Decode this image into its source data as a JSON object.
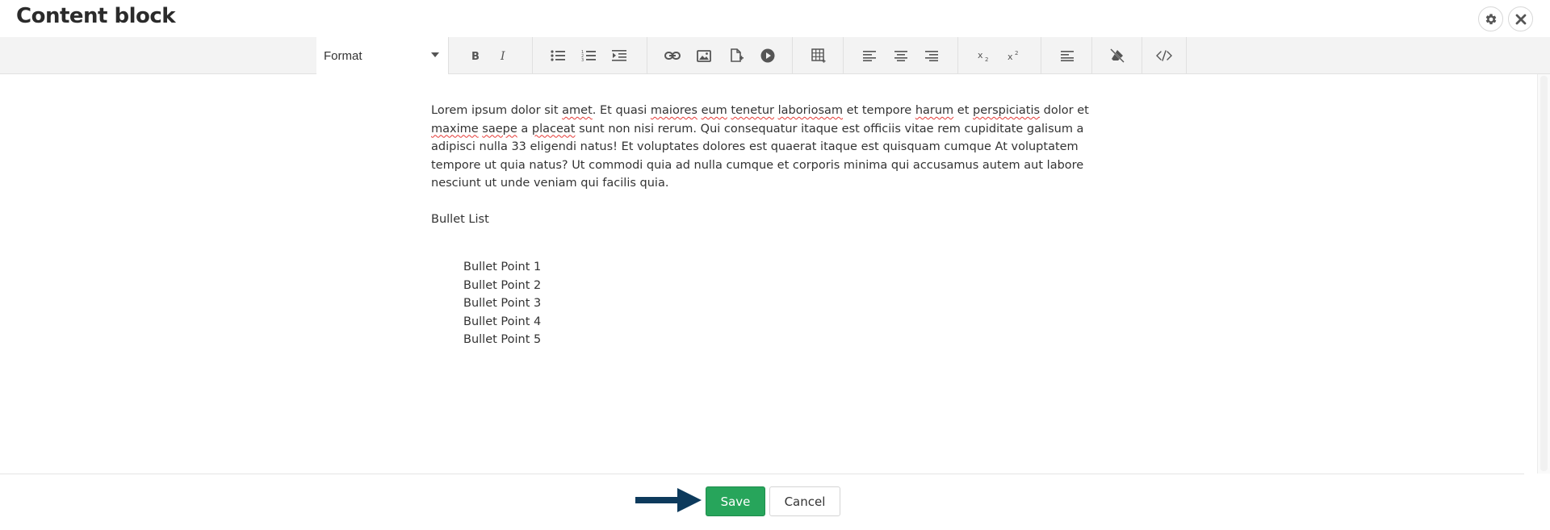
{
  "dialog": {
    "title": "Content block"
  },
  "toolbar": {
    "format_label": "Format"
  },
  "content": {
    "paragraph": [
      {
        "t": "Lorem ipsum dolor sit "
      },
      {
        "t": "amet",
        "spell": true
      },
      {
        "t": ". Et quasi "
      },
      {
        "t": "maiores",
        "spell": true
      },
      {
        "t": " "
      },
      {
        "t": "eum",
        "spell": true
      },
      {
        "t": " "
      },
      {
        "t": "tenetur",
        "spell": true
      },
      {
        "t": " "
      },
      {
        "t": "laboriosam",
        "spell": true
      },
      {
        "t": " et tempore "
      },
      {
        "t": "harum",
        "spell": true
      },
      {
        "t": " et "
      },
      {
        "t": "perspiciatis",
        "spell": true
      },
      {
        "t": " dolor et "
      },
      {
        "t": "maxime",
        "spell": true
      },
      {
        "t": " "
      },
      {
        "t": "saepe",
        "spell": true
      },
      {
        "t": " a "
      },
      {
        "t": "placeat",
        "spell": true
      },
      {
        "t": " sunt non nisi rerum. Qui consequatur itaque est officiis vitae rem cupiditate galisum a adipisci nulla 33 eligendi natus! Et voluptates dolores est quaerat itaque est quisquam cumque At voluptatem tempore ut quia natus? Ut commodi quia ad nulla cumque et corporis minima qui accusamus autem aut labore nesciunt ut unde veniam qui facilis quia."
      }
    ],
    "subheading": "Bullet List",
    "bullets": [
      "Bullet Point 1",
      "Bullet Point 2",
      "Bullet Point 3",
      "Bullet Point 4",
      "Bullet Point 5"
    ]
  },
  "footer": {
    "save_label": "Save",
    "cancel_label": "Cancel"
  },
  "colors": {
    "save_green": "#27a55b",
    "arrow_navy": "#0d3a5c",
    "spellcheck_red": "#e53935"
  },
  "icons": [
    "settings-icon",
    "close-icon",
    "bold-icon",
    "italic-icon",
    "bullet-list-icon",
    "numbered-list-icon",
    "indent-icon",
    "link-icon",
    "image-icon",
    "insert-file-icon",
    "video-icon",
    "table-icon",
    "align-left-icon",
    "align-center-icon",
    "align-right-icon",
    "subscript-icon",
    "superscript-icon",
    "paragraph-format-icon",
    "clear-formatting-icon",
    "code-view-icon",
    "arrow-right-icon"
  ]
}
